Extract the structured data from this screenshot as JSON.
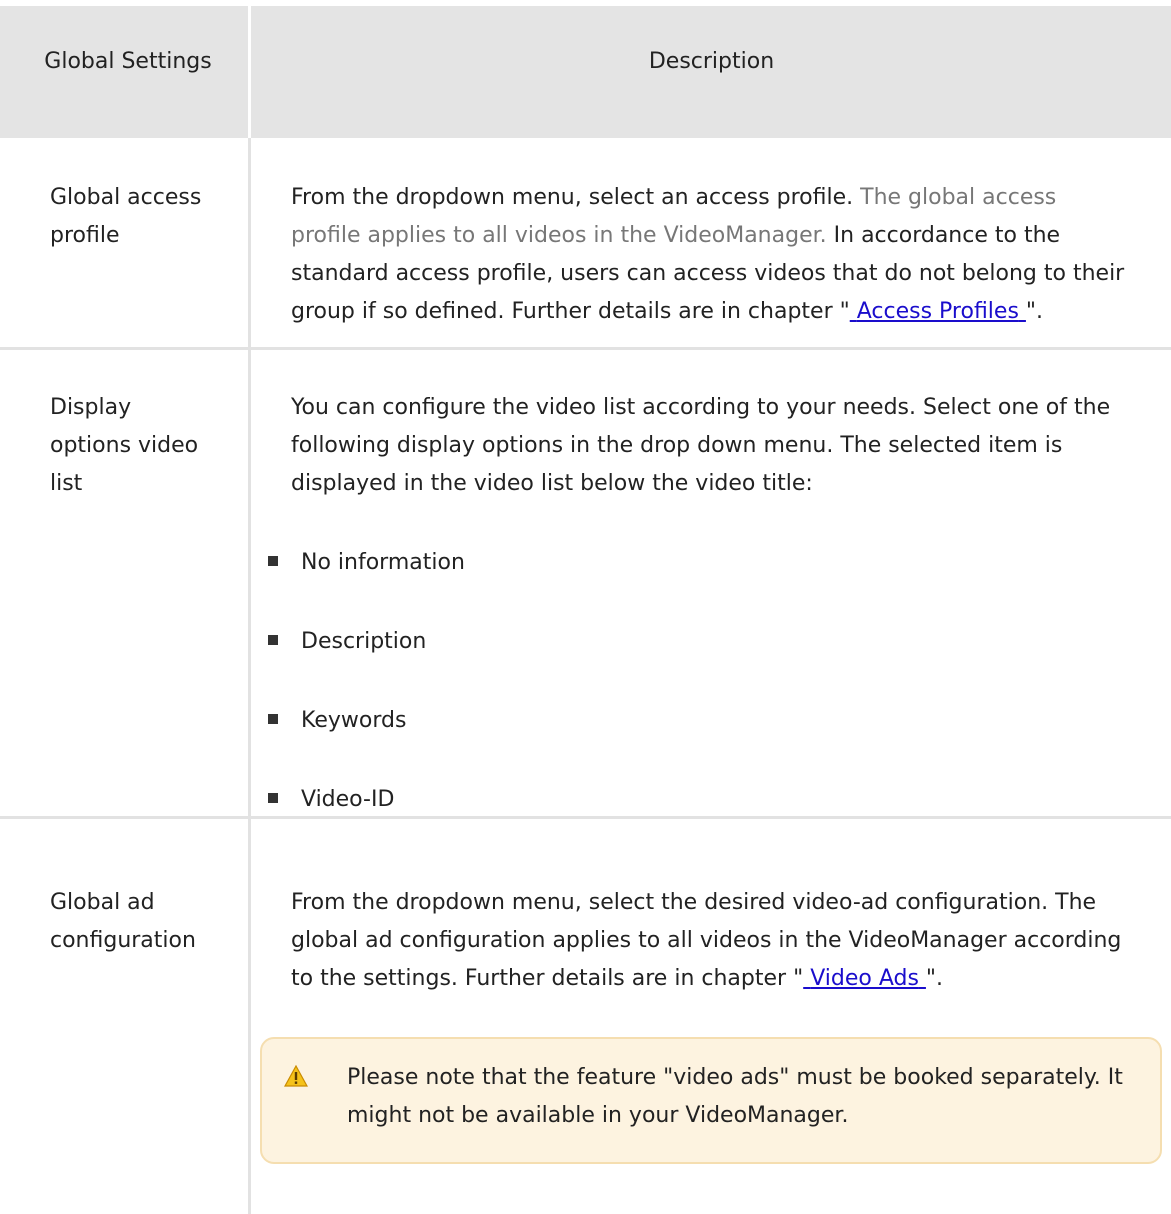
{
  "header": {
    "col1": "Global Settings",
    "col2": "Description"
  },
  "rows": {
    "access": {
      "label": "Global access profile",
      "text_a": "From the dropdown menu, select an access profile.",
      "text_muted": "The global access profile applies to all videos in the VideoManager.",
      "text_b": "In accordance to the standard access profile, users can access videos that do not belong to their group if so defined. Further details are in chapter \"",
      "link": "Access Profiles",
      "text_c": "\"."
    },
    "display": {
      "label": "Display options video list",
      "text": "You can configure the video list according to your needs. Select one of the following display options in the drop down menu. The selected item is displayed in the video list below the video title:",
      "options": [
        "No information",
        "Description",
        "Keywords",
        "Video-ID"
      ]
    },
    "ad": {
      "label": "Global ad configuration",
      "text_a": "From the dropdown menu, select the desired video-ad configuration. The global ad configuration applies to all videos in the VideoManager according to the settings. Further details are in chapter \"",
      "link": "Video Ads",
      "text_b": "\".",
      "note": "Please note that the feature \"video ads\" must be booked separately. It might not be available in your VideoManager.",
      "note_icon": "warning-icon",
      "note_icon_color": "#f2b600"
    }
  }
}
